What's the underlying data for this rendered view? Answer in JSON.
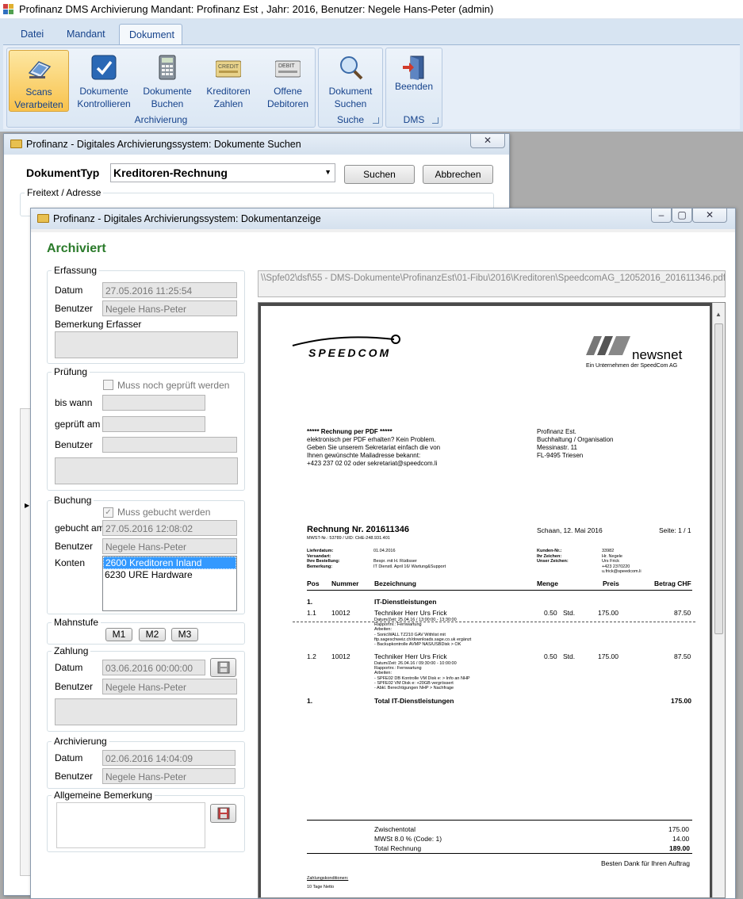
{
  "app": {
    "title": "Profinanz DMS Archivierung     Mandant: Profinanz Est , Jahr: 2016, Benutzer: Negele Hans-Peter (admin)"
  },
  "ribbon": {
    "tabs": [
      "Datei",
      "Mandant",
      "Dokument"
    ],
    "active_tab": "Dokument",
    "groups": {
      "archivierung": "Archivierung",
      "suche": "Suche",
      "dms": "DMS"
    },
    "buttons": {
      "scans": [
        "Scans",
        "Verarbeiten"
      ],
      "kontrollieren": [
        "Dokumente",
        "Kontrollieren"
      ],
      "buchen": [
        "Dokumente",
        "Buchen"
      ],
      "kreditoren": [
        "Kreditoren",
        "Zahlen"
      ],
      "debitoren": [
        "Offene",
        "Debitoren"
      ],
      "suchen": [
        "Dokument",
        "Suchen"
      ],
      "beenden": "Beenden"
    }
  },
  "search_window": {
    "title": "Profinanz - Digitales Archivierungssystem: Dokumente Suchen",
    "doctype_label": "DokumentTyp",
    "doctype_value": "Kreditoren-Rechnung",
    "search_button": "Suchen",
    "cancel_button": "Abbrechen",
    "freetext_label": "Freitext / Adresse"
  },
  "viewer_window": {
    "title": "Profinanz - Digitales Archivierungssystem: Dokumentanzeige",
    "status": "Archiviert",
    "file_path": "\\\\Spfe02\\dsf\\55 - DMS-Dokumente\\ProfinanzEst\\01-Fibu\\2016\\Kreditoren\\SpeedcomAG_12052016_201611346.pdf",
    "erfassung": {
      "legend": "Erfassung",
      "datum_label": "Datum",
      "datum": "27.05.2016 11:25:54",
      "benutzer_label": "Benutzer",
      "benutzer": "Negele Hans-Peter",
      "bemerkung_label": "Bemerkung Erfasser"
    },
    "pruefung": {
      "legend": "Prüfung",
      "check_label": "Muss noch geprüft werden",
      "bis_wann_label": "bis wann",
      "geprueft_am_label": "geprüft am",
      "benutzer_label": "Benutzer"
    },
    "buchung": {
      "legend": "Buchung",
      "check_label": "Muss gebucht werden",
      "gebucht_am_label": "gebucht am",
      "gebucht_am": "27.05.2016 12:08:02",
      "benutzer_label": "Benutzer",
      "benutzer": "Negele Hans-Peter",
      "konten_label": "Konten",
      "konten": [
        "2600 Kreditoren Inland",
        "6230 URE Hardware"
      ]
    },
    "mahnstufe": {
      "legend": "Mahnstufe",
      "buttons": [
        "M1",
        "M2",
        "M3"
      ]
    },
    "zahlung": {
      "legend": "Zahlung",
      "datum_label": "Datum",
      "datum": "03.06.2016 00:00:00",
      "benutzer_label": "Benutzer",
      "benutzer": "Negele Hans-Peter"
    },
    "archivierung": {
      "legend": "Archivierung",
      "datum_label": "Datum",
      "datum": "02.06.2016 14:04:09",
      "benutzer_label": "Benutzer",
      "benutzer": "Negele Hans-Peter"
    },
    "bemerkung_legend": "Allgemeine Bemerkung"
  },
  "invoice": {
    "speedcom_logo": "SPEEDCOM",
    "newsnet_logo": "newsnet",
    "newsnet_sub": "Ein Unternehmen der SpeedCom AG",
    "intro": [
      "***** Rechnung per PDF *****",
      "elektronisch per PDF erhalten? Kein Problem.",
      "Geben Sie unserem Sekretariat einfach die von",
      "Ihnen gewünschte Mailadresse bekannt:",
      "+423 237 02 02 oder sekretariat@speedcom.li"
    ],
    "address": [
      "Profinanz Est.",
      "Buchhaltung / Organisation",
      "Messinastr. 11",
      "FL-9495 Triesen"
    ],
    "title": "Rechnung Nr. 201611346",
    "mwst": "MWST-Nr.: 53789  /  UID: CHE-248.931.401",
    "date": "Schaan, 12. Mai 2016",
    "page": "Seite: 1 / 1",
    "meta_left_labels": [
      "Lieferdatum:",
      "Versandart:",
      "Ihre Bestellung:",
      "Bemerkung:"
    ],
    "meta_left_values": [
      "01.04.2016",
      "",
      "Bespr. mit H. Rüdisser",
      "IT Dienstl. April 16/ Wartung&Support"
    ],
    "meta_right_labels": [
      "Kunden-Nr.:",
      "Ihr Zeichen:",
      "Unser Zeichen:"
    ],
    "meta_right_values": [
      "33982",
      "Hr. Negele",
      "Urs Frick",
      "+423 2370220",
      "u.frick@speedcom.li"
    ],
    "columns": [
      "Pos",
      "Nummer",
      "Bezeichnung",
      "Menge",
      "Preis",
      "Betrag CHF"
    ],
    "group_pos": "1.",
    "group_name": "IT-Dienstleistungen",
    "rows": [
      {
        "pos": "1.1",
        "nummer": "10012",
        "bez": "Techniker Herr Urs Frick",
        "menge": "0.50",
        "einheit": "Std.",
        "preis": "175.00",
        "betrag": "87.50",
        "details": [
          "Datum/Zeit: 25.04.16 / 13:00:00 - 13:30:00",
          "Rapportnr.: Fernwartung",
          "Arbeiten:",
          "- SonicWALL TZ210 GAV Withlist mit",
          "ftp.sageschweiz.ch/downloads.sage.co.uk ergänzt",
          "- Backupkontrolle AVMP NAS/USBDisk > OK"
        ]
      },
      {
        "pos": "1.2",
        "nummer": "10012",
        "bez": "Techniker Herr Urs Frick",
        "menge": "0.50",
        "einheit": "Std.",
        "preis": "175.00",
        "betrag": "87.50",
        "details": [
          "Datum/Zeit: 26.04.16 / 09:30:00 - 10:00:00",
          "Rapportnr.: Fernwartung",
          "Arbeiten:",
          "- SPFE02 DB Kontrolle VM Disk e: > Info an NHP",
          "- SPFE02 VM Disk e: +20GB vergrössert",
          "- Abkl. Berechtigungen NHP > Nachfrage"
        ]
      }
    ],
    "total_group_pos": "1.",
    "total_group_label": "Total IT-Dienstleistungen",
    "total_group_value": "175.00",
    "zwischentotal_label": "Zwischentotal",
    "zwischentotal": "175.00",
    "mwst_label": "MWSt 8.0 % (Code: 1)",
    "mwst_value": "14.00",
    "total_label": "Total Rechnung",
    "total_value": "189.00",
    "thanks": "Besten Dank für Ihren Auftrag",
    "zahlungskonditionen": "Zahlungskonditionen:",
    "netto": "10 Tage Netto"
  }
}
